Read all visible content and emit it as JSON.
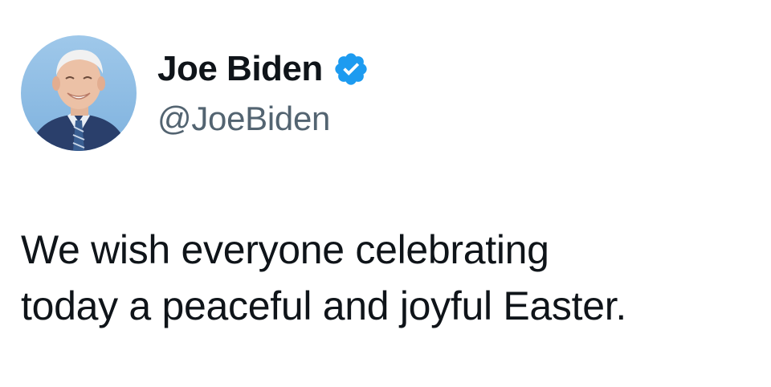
{
  "tweet": {
    "author": {
      "display_name": "Joe Biden",
      "handle": "@JoeBiden",
      "verified": true,
      "verified_color": "#1d9bf0",
      "avatar_icon": "user-avatar-photo"
    },
    "text_lines": [
      "We wish everyone celebrating",
      "today a peaceful and joyful Easter."
    ]
  },
  "colors": {
    "background": "#ffffff",
    "primary_text": "#0f1419",
    "secondary_text": "#536471",
    "accent": "#1d9bf0"
  }
}
